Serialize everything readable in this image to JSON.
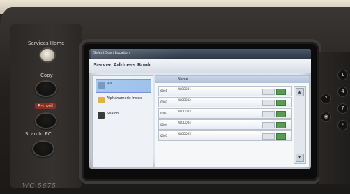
{
  "panel": {
    "services_home": "Services Home",
    "copy": "Copy",
    "email": "E-mail",
    "scan_to_pc": "Scan to PC",
    "model": "WC 5675"
  },
  "screen": {
    "topbar": "Select Scan Location",
    "title": "Server Address Book",
    "nav": [
      {
        "label": "All"
      },
      {
        "label": "Alphanumeric Index"
      },
      {
        "label": "Search"
      }
    ],
    "column_name": "Name",
    "rows": [
      {
        "num": "0001",
        "name": "WCCO01"
      },
      {
        "num": "0002",
        "name": "WCCO02"
      },
      {
        "num": "0003",
        "name": "WCCO03"
      },
      {
        "num": "0004",
        "name": "WCCO04"
      },
      {
        "num": "0005",
        "name": "WCCO05"
      }
    ]
  },
  "colors": {
    "selection": "#9fc2ea",
    "check": "#5a9b55",
    "email_key": "#8a2f20"
  }
}
